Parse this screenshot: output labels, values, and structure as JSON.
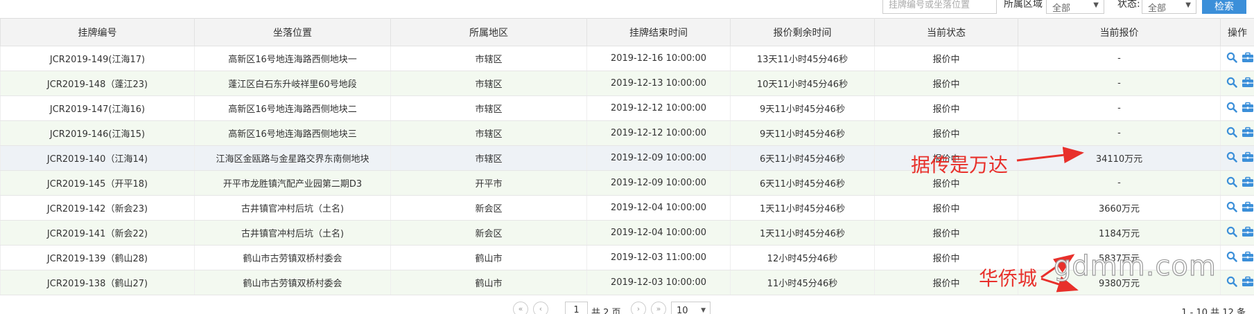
{
  "filters": {
    "search_placeholder": "挂牌编号或坐落位置",
    "region_label": "所属区域",
    "region_value": "全部",
    "status_label": "状态:",
    "status_value": "全部",
    "search_button": "检索"
  },
  "columns": [
    "挂牌编号",
    "坐落位置",
    "所属地区",
    "挂牌结束时间",
    "报价剩余时间",
    "当前状态",
    "当前报价",
    "操作"
  ],
  "rows": [
    {
      "code": "JCR2019-149(江海17)",
      "location": "高新区16号地连海路西侧地块一",
      "district": "市辖区",
      "end_time": "2019-12-16 10:00:00",
      "remaining": "13天11小时45分46秒",
      "status": "报价中",
      "price": "-"
    },
    {
      "code": "JCR2019-148（蓬江23)",
      "location": "蓬江区白石东升岐祥里60号地段",
      "district": "市辖区",
      "end_time": "2019-12-13 10:00:00",
      "remaining": "10天11小时45分46秒",
      "status": "报价中",
      "price": "-"
    },
    {
      "code": "JCR2019-147(江海16)",
      "location": "高新区16号地连海路西侧地块二",
      "district": "市辖区",
      "end_time": "2019-12-12 10:00:00",
      "remaining": "9天11小时45分46秒",
      "status": "报价中",
      "price": "-"
    },
    {
      "code": "JCR2019-146(江海15)",
      "location": "高新区16号地连海路西侧地块三",
      "district": "市辖区",
      "end_time": "2019-12-12 10:00:00",
      "remaining": "9天11小时45分46秒",
      "status": "报价中",
      "price": "-"
    },
    {
      "code": "JCR2019-140（江海14)",
      "location": "江海区金瓯路与金星路交界东南侧地块",
      "district": "市辖区",
      "end_time": "2019-12-09 10:00:00",
      "remaining": "6天11小时45分46秒",
      "status": "报价中",
      "price": "34110万元"
    },
    {
      "code": "JCR2019-145（开平18)",
      "location": "开平市龙胜镇汽配产业园第二期D3",
      "district": "开平市",
      "end_time": "2019-12-09 10:00:00",
      "remaining": "6天11小时45分46秒",
      "status": "报价中",
      "price": "-"
    },
    {
      "code": "JCR2019-142（新会23)",
      "location": "古井镇官冲村后坑（土名)",
      "district": "新会区",
      "end_time": "2019-12-04 10:00:00",
      "remaining": "1天11小时45分46秒",
      "status": "报价中",
      "price": "3660万元"
    },
    {
      "code": "JCR2019-141（新会22)",
      "location": "古井镇官冲村后坑（土名)",
      "district": "新会区",
      "end_time": "2019-12-04 10:00:00",
      "remaining": "1天11小时45分46秒",
      "status": "报价中",
      "price": "1184万元"
    },
    {
      "code": "JCR2019-139（鹤山28)",
      "location": "鹤山市古劳镇双桥村委会",
      "district": "鹤山市",
      "end_time": "2019-12-03 11:00:00",
      "remaining": "12小时45分46秒",
      "status": "报价中",
      "price": "5837万元"
    },
    {
      "code": "JCR2019-138（鹤山27)",
      "location": "鹤山市古劳镇双桥村委会",
      "district": "鹤山市",
      "end_time": "2019-12-03 10:00:00",
      "remaining": "11小时45分46秒",
      "status": "报价中",
      "price": "9380万元"
    }
  ],
  "pagination": {
    "first": "«",
    "prev": "‹",
    "current_page": "1",
    "total_pages": "共 2 页",
    "next": "›",
    "last": "»",
    "page_size": "10",
    "summary": "1 - 10   共 12 条"
  },
  "annotations": {
    "wanda": "据传是万达",
    "huaqiaocheng": "华侨城",
    "watermark": "gdmm.com",
    "color": "#e8302b"
  },
  "icons": {
    "view": "magnifier-icon",
    "operate": "briefcase-icon",
    "icon_color": "#3b8fd9"
  }
}
